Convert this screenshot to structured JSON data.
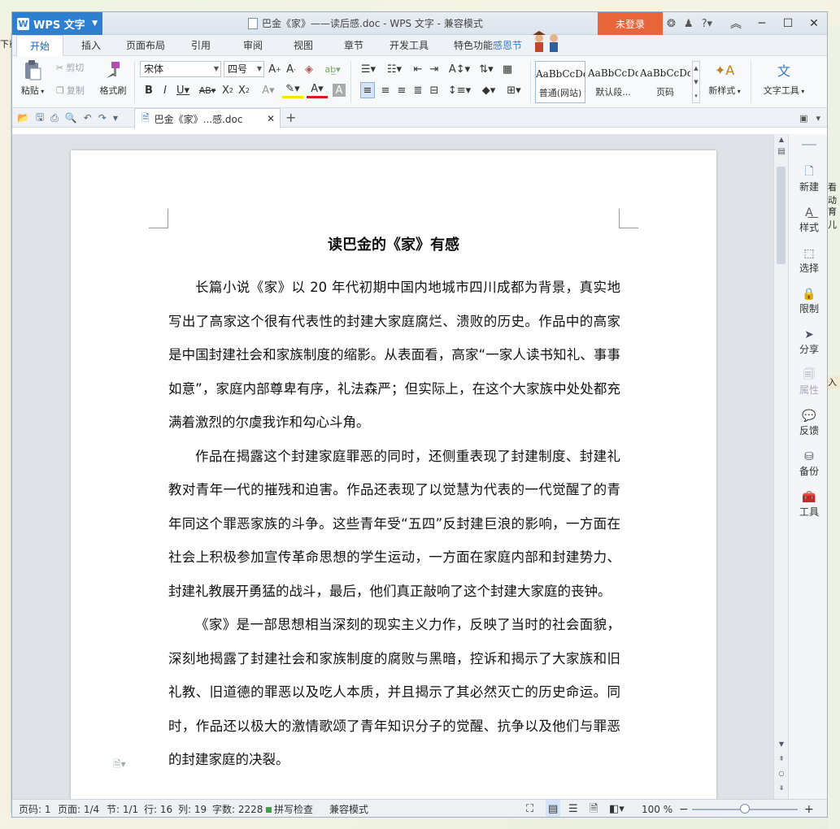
{
  "desktop": {
    "left_frag": "下载",
    "right_frags": [
      "看动",
      "育儿",
      "入"
    ]
  },
  "titlebar": {
    "app_button": "WPS 文字",
    "window_title": "巴金《家》——读后感.doc - WPS 文字 - 兼容模式",
    "login": "未登录"
  },
  "menu": {
    "tabs": [
      "开始",
      "插入",
      "页面布局",
      "引用",
      "审阅",
      "视图",
      "章节",
      "开发工具",
      "特色功能"
    ],
    "extra": "感恩节"
  },
  "ribbon": {
    "paste": "粘贴",
    "cut": "剪切",
    "copy": "复制",
    "format_painter": "格式刷",
    "font_name": "宋体",
    "font_size": "四号",
    "styles": [
      {
        "preview": "AaBbCcDd",
        "label": "普通(网站)"
      },
      {
        "preview": "AaBbCcDd",
        "label": "默认段..."
      },
      {
        "preview": "AaBbCcDd",
        "label": "页码"
      }
    ],
    "new_style": "新样式",
    "text_tools": "文字工具"
  },
  "doc_tabs": {
    "active": "巴金《家》...感.doc"
  },
  "document": {
    "title": "读巴金的《家》有感",
    "paragraphs": [
      "长篇小说《家》以 20 年代初期中国内地城市四川成都为背景，真实地写出了高家这个很有代表性的封建大家庭腐烂、溃败的历史。作品中的高家是中国封建社会和家族制度的缩影。从表面看，高家“一家人读书知礼、事事如意”，家庭内部尊卑有序，礼法森严；但实际上，在这个大家族中处处都充满着激烈的尔虞我诈和勾心斗角。",
      "作品在揭露这个封建家庭罪恶的同时，还侧重表现了封建制度、封建礼教对青年一代的摧残和迫害。作品还表现了以觉慧为代表的一代觉醒了的青年同这个罪恶家族的斗争。这些青年受“五四”反封建巨浪的影响，一方面在社会上积极参加宣传革命思想的学生运动，一方面在家庭内部和封建势力、封建礼教展开勇猛的战斗，最后，他们真正敲响了这个封建大家庭的丧钟。",
      "《家》是一部思想相当深刻的现实主义力作，反映了当时的社会面貌，深刻地揭露了封建社会和家族制度的腐败与黑暗，控诉和揭示了大家族和旧礼教、旧道德的罪恶以及吃人本质，并且揭示了其必然灭亡的历史命运。同时，作品还以极大的激情歌颂了青年知识分子的觉醒、抗争以及他们与罪恶的封建家庭的决裂。"
    ]
  },
  "taskpane": {
    "items": [
      "新建",
      "样式",
      "选择",
      "限制",
      "分享",
      "属性",
      "反馈",
      "备份",
      "工具"
    ]
  },
  "statusbar": {
    "page_num": "页码: 1",
    "pages": "页面: 1/4",
    "section": "节: 1/1",
    "row": "行: 16",
    "col": "列: 19",
    "word_count": "字数: 2228",
    "spell_check": "拼写检查",
    "compat_mode": "兼容模式",
    "zoom": "100 %"
  }
}
